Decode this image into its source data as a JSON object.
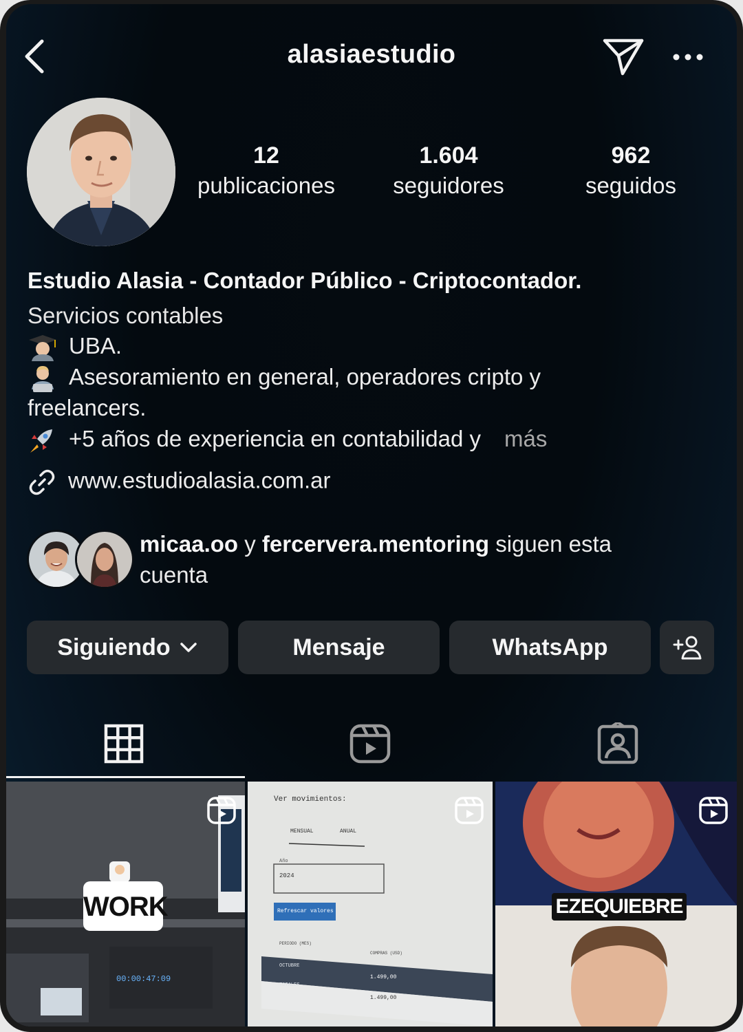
{
  "header": {
    "username": "alasiaestudio"
  },
  "stats": [
    {
      "value": "12",
      "label": "publicaciones"
    },
    {
      "value": "1.604",
      "label": "seguidores"
    },
    {
      "value": "962",
      "label": "seguidos"
    }
  ],
  "bio": {
    "name": "Estudio Alasia - Contador Público - Criptocontador.",
    "category": "Servicios contables",
    "lines": [
      {
        "emoji": "graduate-emoji",
        "text": "UBA."
      },
      {
        "emoji": "technologist-emoji",
        "text": "Asesoramiento en general, operadores cripto y"
      },
      {
        "emoji": "",
        "text": "freelancers."
      },
      {
        "emoji": "rocket-emoji",
        "text": "+5 años de experiencia en contabilidad y"
      }
    ],
    "more": "más",
    "website": "www.estudioalasia.com.ar"
  },
  "followed_by": {
    "user1": "micaa.oo",
    "connector": "y",
    "user2": "fercervera.mentoring",
    "suffix": "siguen esta",
    "suffix2": "cuenta"
  },
  "buttons": {
    "following": "Siguiendo",
    "message": "Mensaje",
    "whatsapp": "WhatsApp"
  },
  "tabs": [
    "grid-icon",
    "reels-icon",
    "tagged-icon"
  ],
  "posts": [
    {
      "caption": "WORK",
      "type": "reel"
    },
    {
      "caption": "Ver movimientos:",
      "type": "reel",
      "sub1": "MENSUAL",
      "sub2": "ANUAL",
      "field_label": "Año",
      "field_value": "2024",
      "button": "Refrescar valores",
      "col1": "PERIODO (MES)",
      "col2": "COMPRAS (USD)",
      "row1": "OCTUBRE",
      "row1v": "1.499,00",
      "row2": "TOTALES",
      "row2v": "1.499,00"
    },
    {
      "caption": "EZEQUIEBRE",
      "type": "reel"
    }
  ],
  "colors": {
    "background": "#040a0f",
    "button": "#262a2e",
    "muted": "#a8a8a8"
  }
}
